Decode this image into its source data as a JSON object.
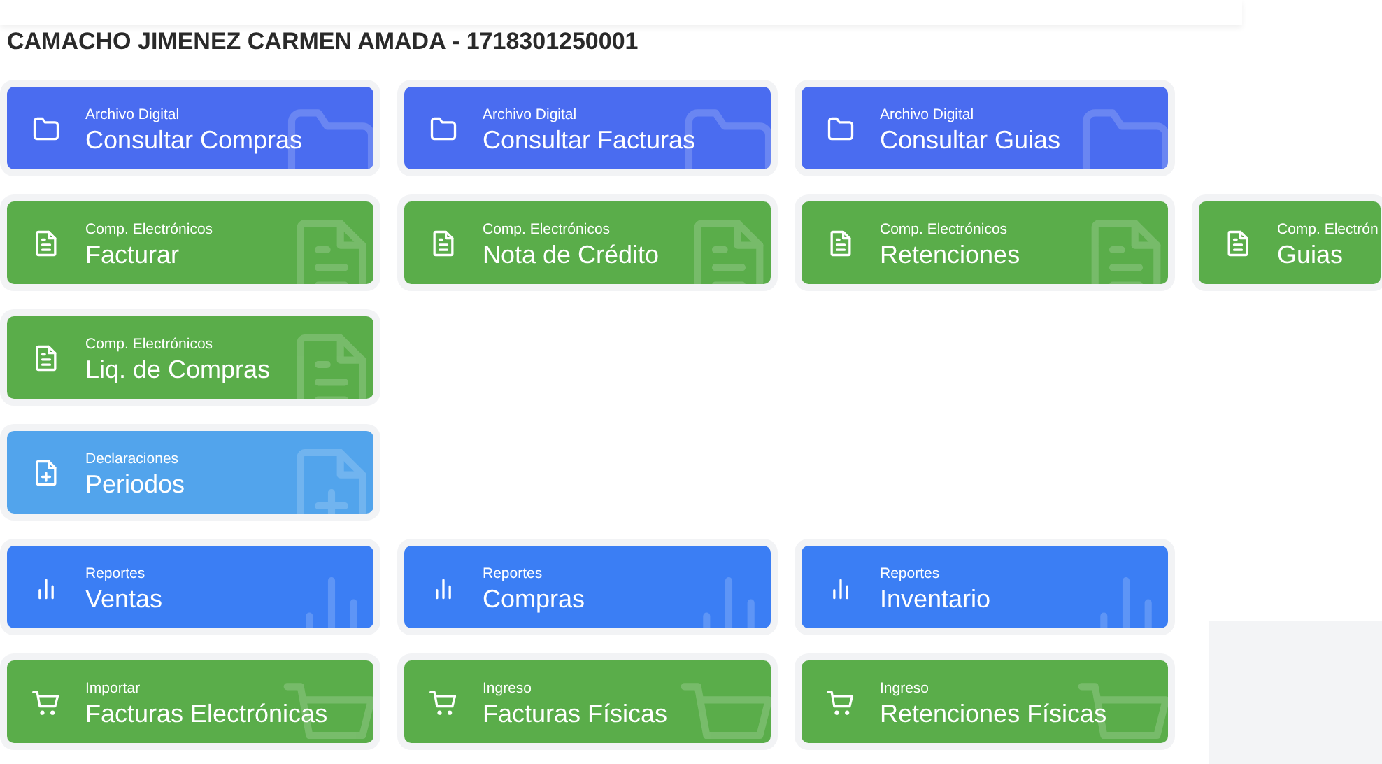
{
  "header": {
    "title": "CAMACHO JIMENEZ CARMEN AMADA - 1718301250001"
  },
  "rows": [
    {
      "tiles": [
        {
          "kind": "folder",
          "color": "#4a6cf0",
          "category": "Archivo Digital",
          "label": "Consultar Compras"
        },
        {
          "kind": "folder",
          "color": "#4a6cf0",
          "category": "Archivo Digital",
          "label": "Consultar Facturas"
        },
        {
          "kind": "folder",
          "color": "#4a6cf0",
          "category": "Archivo Digital",
          "label": "Consultar Guias"
        }
      ]
    },
    {
      "tiles": [
        {
          "kind": "document",
          "color": "#5aad4a",
          "category": "Comp. Electrónicos",
          "label": "Facturar"
        },
        {
          "kind": "document",
          "color": "#5aad4a",
          "category": "Comp. Electrónicos",
          "label": "Nota de Crédito"
        },
        {
          "kind": "document",
          "color": "#5aad4a",
          "category": "Comp. Electrónicos",
          "label": "Retenciones"
        },
        {
          "kind": "document",
          "color": "#5aad4a",
          "category": "Comp. Electrón",
          "label": "Guias"
        }
      ]
    },
    {
      "tiles": [
        {
          "kind": "document",
          "color": "#5aad4a",
          "category": "Comp. Electrónicos",
          "label": "Liq. de Compras"
        }
      ]
    },
    {
      "tiles": [
        {
          "kind": "document-plus",
          "color": "#52a4ec",
          "category": "Declaraciones",
          "label": "Periodos"
        }
      ]
    },
    {
      "tiles": [
        {
          "kind": "chart",
          "color": "#3b7ef4",
          "category": "Reportes",
          "label": "Ventas"
        },
        {
          "kind": "chart",
          "color": "#3b7ef4",
          "category": "Reportes",
          "label": "Compras"
        },
        {
          "kind": "chart",
          "color": "#3b7ef4",
          "category": "Reportes",
          "label": "Inventario"
        }
      ]
    },
    {
      "tiles": [
        {
          "kind": "cart",
          "color": "#5aad4a",
          "category": "Importar",
          "label": "Facturas Electrónicas"
        },
        {
          "kind": "cart",
          "color": "#5aad4a",
          "category": "Ingreso",
          "label": "Facturas Físicas"
        },
        {
          "kind": "cart",
          "color": "#5aad4a",
          "category": "Ingreso",
          "label": "Retenciones Físicas"
        }
      ]
    }
  ]
}
